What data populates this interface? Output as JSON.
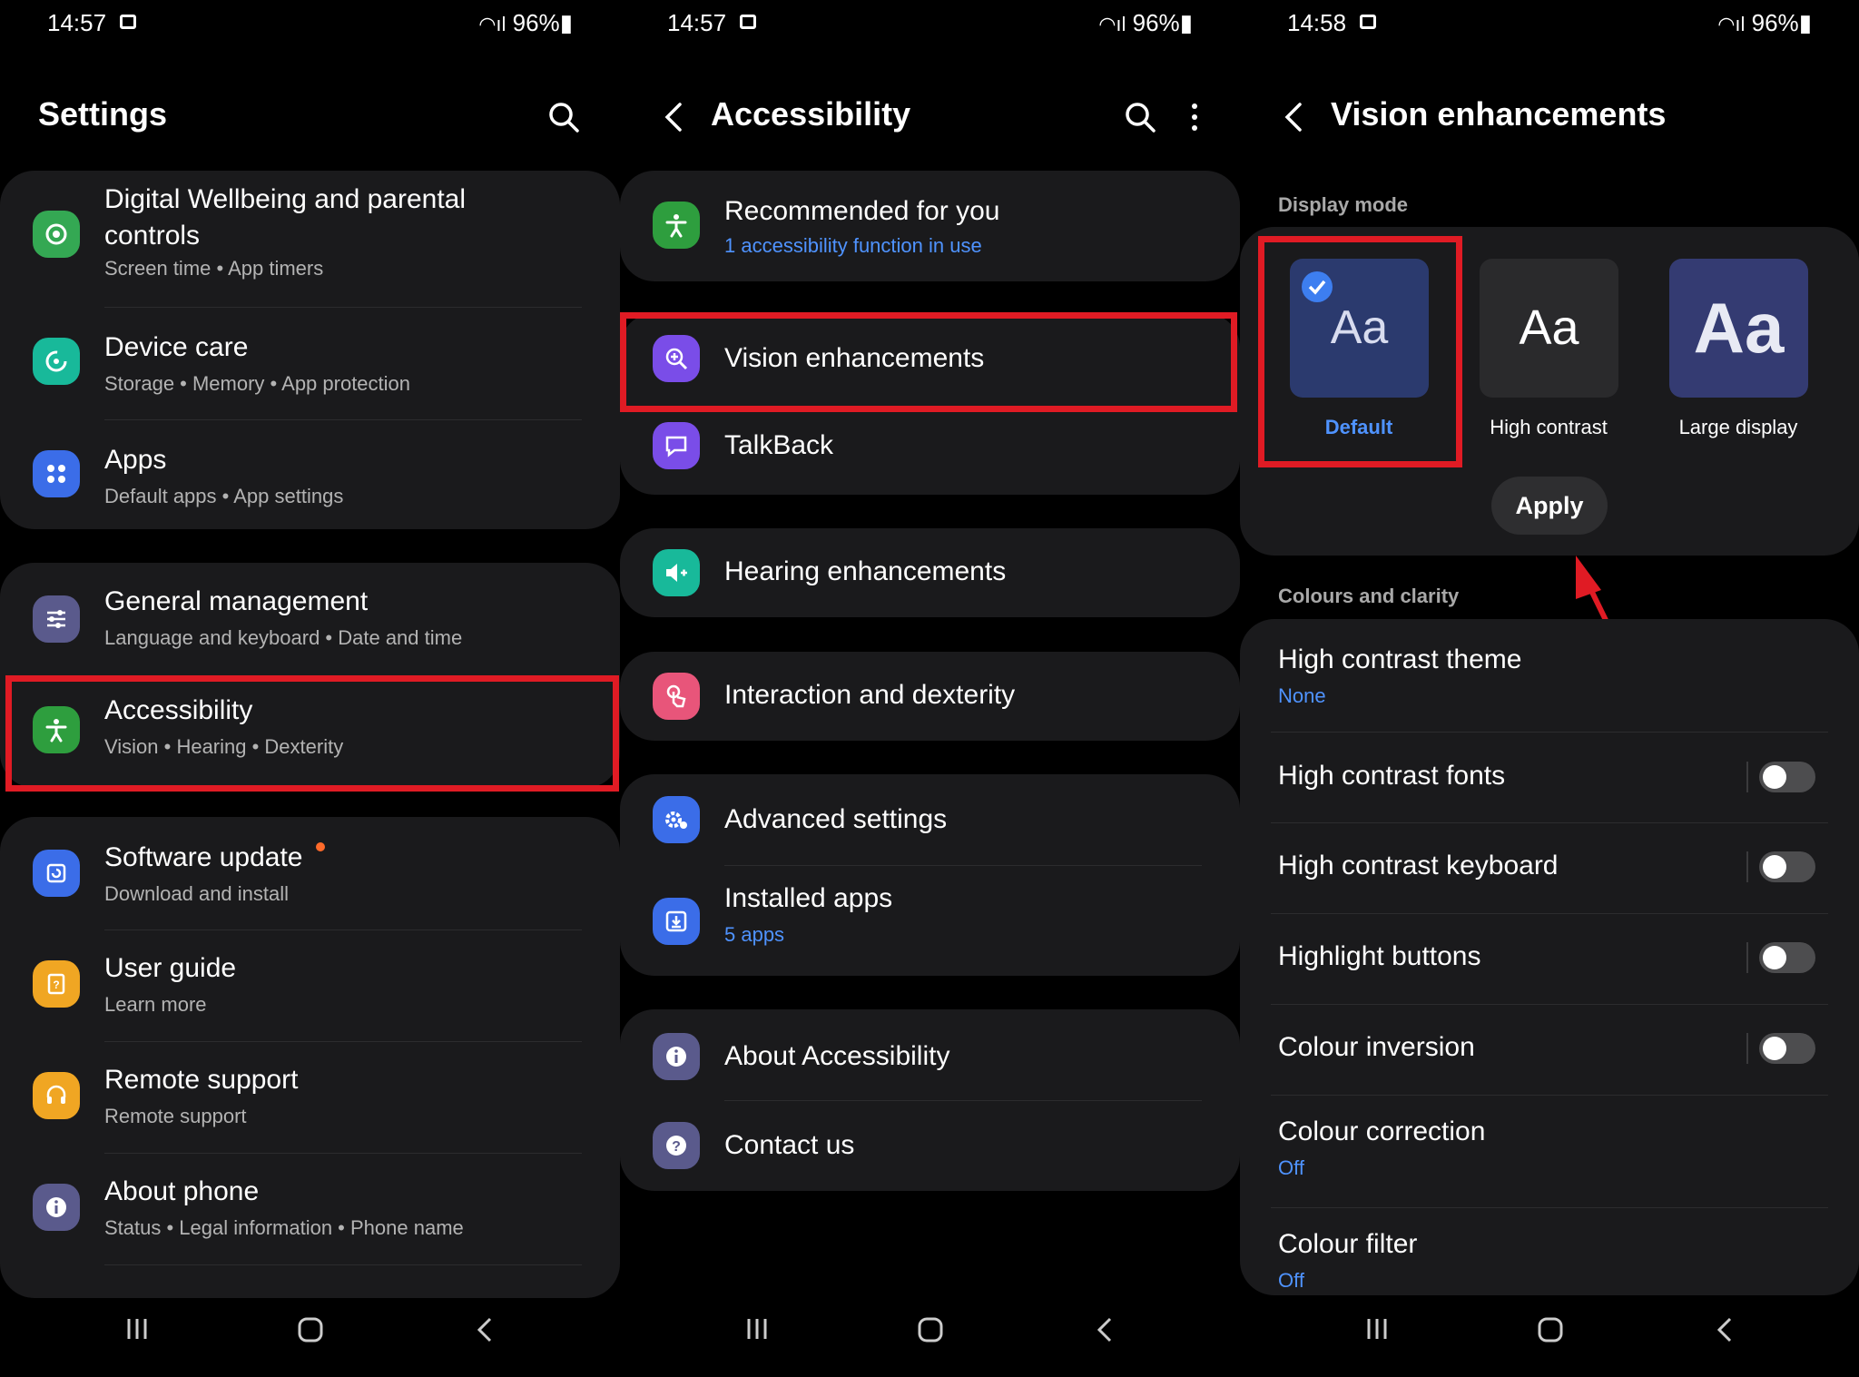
{
  "status_bars": [
    {
      "time": "14:57",
      "battery": "96%"
    },
    {
      "time": "14:57",
      "battery": "96%"
    },
    {
      "time": "14:58",
      "battery": "96%"
    }
  ],
  "settings": {
    "title": "Settings",
    "items": [
      {
        "title": "Digital Wellbeing and parental controls",
        "subtitle": "Screen time  •  App timers",
        "icon": "wellbeing-icon",
        "color": "#34a853"
      },
      {
        "title": "Device care",
        "subtitle": "Storage  •  Memory  •  App protection",
        "icon": "device-care-icon",
        "color": "#18b99a"
      },
      {
        "title": "Apps",
        "subtitle": "Default apps  •  App settings",
        "icon": "apps-icon",
        "color": "#3b6de8"
      },
      {
        "title": "General management",
        "subtitle": "Language and keyboard  •  Date and time",
        "icon": "general-management-icon",
        "color": "#5a5a8c"
      },
      {
        "title": "Accessibility",
        "subtitle": "Vision  •  Hearing  •  Dexterity",
        "icon": "accessibility-icon",
        "color": "#2e9e3e"
      },
      {
        "title": "Software update",
        "subtitle": "Download and install",
        "icon": "software-update-icon",
        "color": "#3b6de8"
      },
      {
        "title": "User guide",
        "subtitle": "Learn more",
        "icon": "user-guide-icon",
        "color": "#f0a623"
      },
      {
        "title": "Remote support",
        "subtitle": "Remote support",
        "icon": "remote-support-icon",
        "color": "#f0a623"
      },
      {
        "title": "About phone",
        "subtitle": "Status  •  Legal information  •  Phone name",
        "icon": "about-phone-icon",
        "color": "#5a5a8c"
      }
    ]
  },
  "accessibility": {
    "title": "Accessibility",
    "items": [
      {
        "title": "Recommended for you",
        "subtitle": "1 accessibility function in use",
        "icon": "accessibility-icon",
        "color": "#2e9e3e"
      },
      {
        "title": "Vision enhancements",
        "icon": "vision-icon",
        "color": "#7a4de8"
      },
      {
        "title": "TalkBack",
        "icon": "talkback-icon",
        "color": "#7a4de8"
      },
      {
        "title": "Hearing enhancements",
        "icon": "hearing-icon",
        "color": "#18b99a"
      },
      {
        "title": "Interaction and dexterity",
        "icon": "interaction-icon",
        "color": "#e8557a"
      },
      {
        "title": "Advanced settings",
        "icon": "advanced-settings-icon",
        "color": "#3b6de8"
      },
      {
        "title": "Installed apps",
        "subtitle": "5 apps",
        "icon": "installed-apps-icon",
        "color": "#3b6de8"
      },
      {
        "title": "About Accessibility",
        "icon": "info-icon",
        "color": "#5a5a8c"
      },
      {
        "title": "Contact us",
        "icon": "help-icon",
        "color": "#5a5a8c"
      }
    ]
  },
  "vision": {
    "title": "Vision enhancements",
    "display_mode_label": "Display mode",
    "modes": [
      {
        "label": "Default",
        "glyph": "Aa",
        "selected": true
      },
      {
        "label": "High contrast",
        "glyph": "Aa",
        "selected": false
      },
      {
        "label": "Large display",
        "glyph": "Aa",
        "selected": false
      }
    ],
    "apply_label": "Apply",
    "colours_label": "Colours and clarity",
    "items": [
      {
        "title": "High contrast theme",
        "subtitle": "None"
      },
      {
        "title": "High contrast fonts",
        "toggle": false
      },
      {
        "title": "High contrast keyboard",
        "toggle": false
      },
      {
        "title": "Highlight buttons",
        "toggle": false
      },
      {
        "title": "Colour inversion",
        "toggle": false
      },
      {
        "title": "Colour correction",
        "subtitle": "Off"
      },
      {
        "title": "Colour filter",
        "subtitle": "Off"
      }
    ]
  },
  "colors": {
    "highlight": "#e01b24",
    "link_blue": "#4f93ff",
    "card": "#1a1a1c"
  }
}
